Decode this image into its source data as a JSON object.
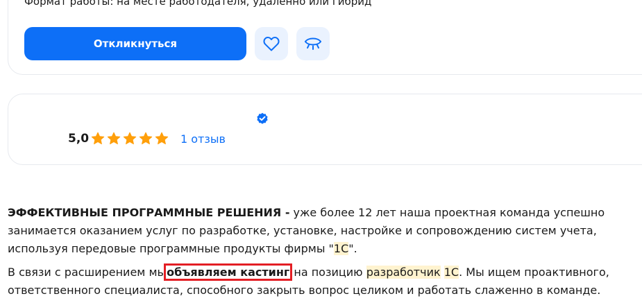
{
  "vacancy": {
    "work_format": "Формат работы: на месте работодателя, удаленно или гибрид",
    "apply_label": "Откликнуться",
    "favorite_icon": "heart-icon",
    "hide_icon": "eye-closed-icon"
  },
  "employer": {
    "verified_icon": "verified-check-icon",
    "rating": "5,0",
    "stars": 5,
    "reviews_link": "1 отзыв",
    "colors": {
      "star": "#ff9f0a",
      "link": "#0d6ff7",
      "badge": "#0d6ff7"
    }
  },
  "description": {
    "p1_bold": "ЭФФЕКТИВНЫЕ ПРОГРАММНЫЕ РЕШЕНИЯ -",
    "p1_text_a": " уже более 12 лет наша проектная команда успешно занимается оказанием услуг по разработке, установке, настройке и сопровождению систем учета, используя передовые программные продукты фирмы \"",
    "p1_hl": "1С",
    "p1_text_b": "\".",
    "p2_text_a": "В связи с расширением мы",
    "p2_boxed": "объявляем кастинг",
    "p2_text_b": " на позицию ",
    "p2_hl1": "разработчик",
    "p2_space": " ",
    "p2_hl2": "1С",
    "p2_text_c": ". Мы ищем проактивного, ответственного специалиста, способного закрыть вопрос целиком и работать слаженно в команде."
  },
  "colors": {
    "primary": "#0d6ff7",
    "highlight": "#fff3cf",
    "annotation_box": "#e31e24"
  }
}
